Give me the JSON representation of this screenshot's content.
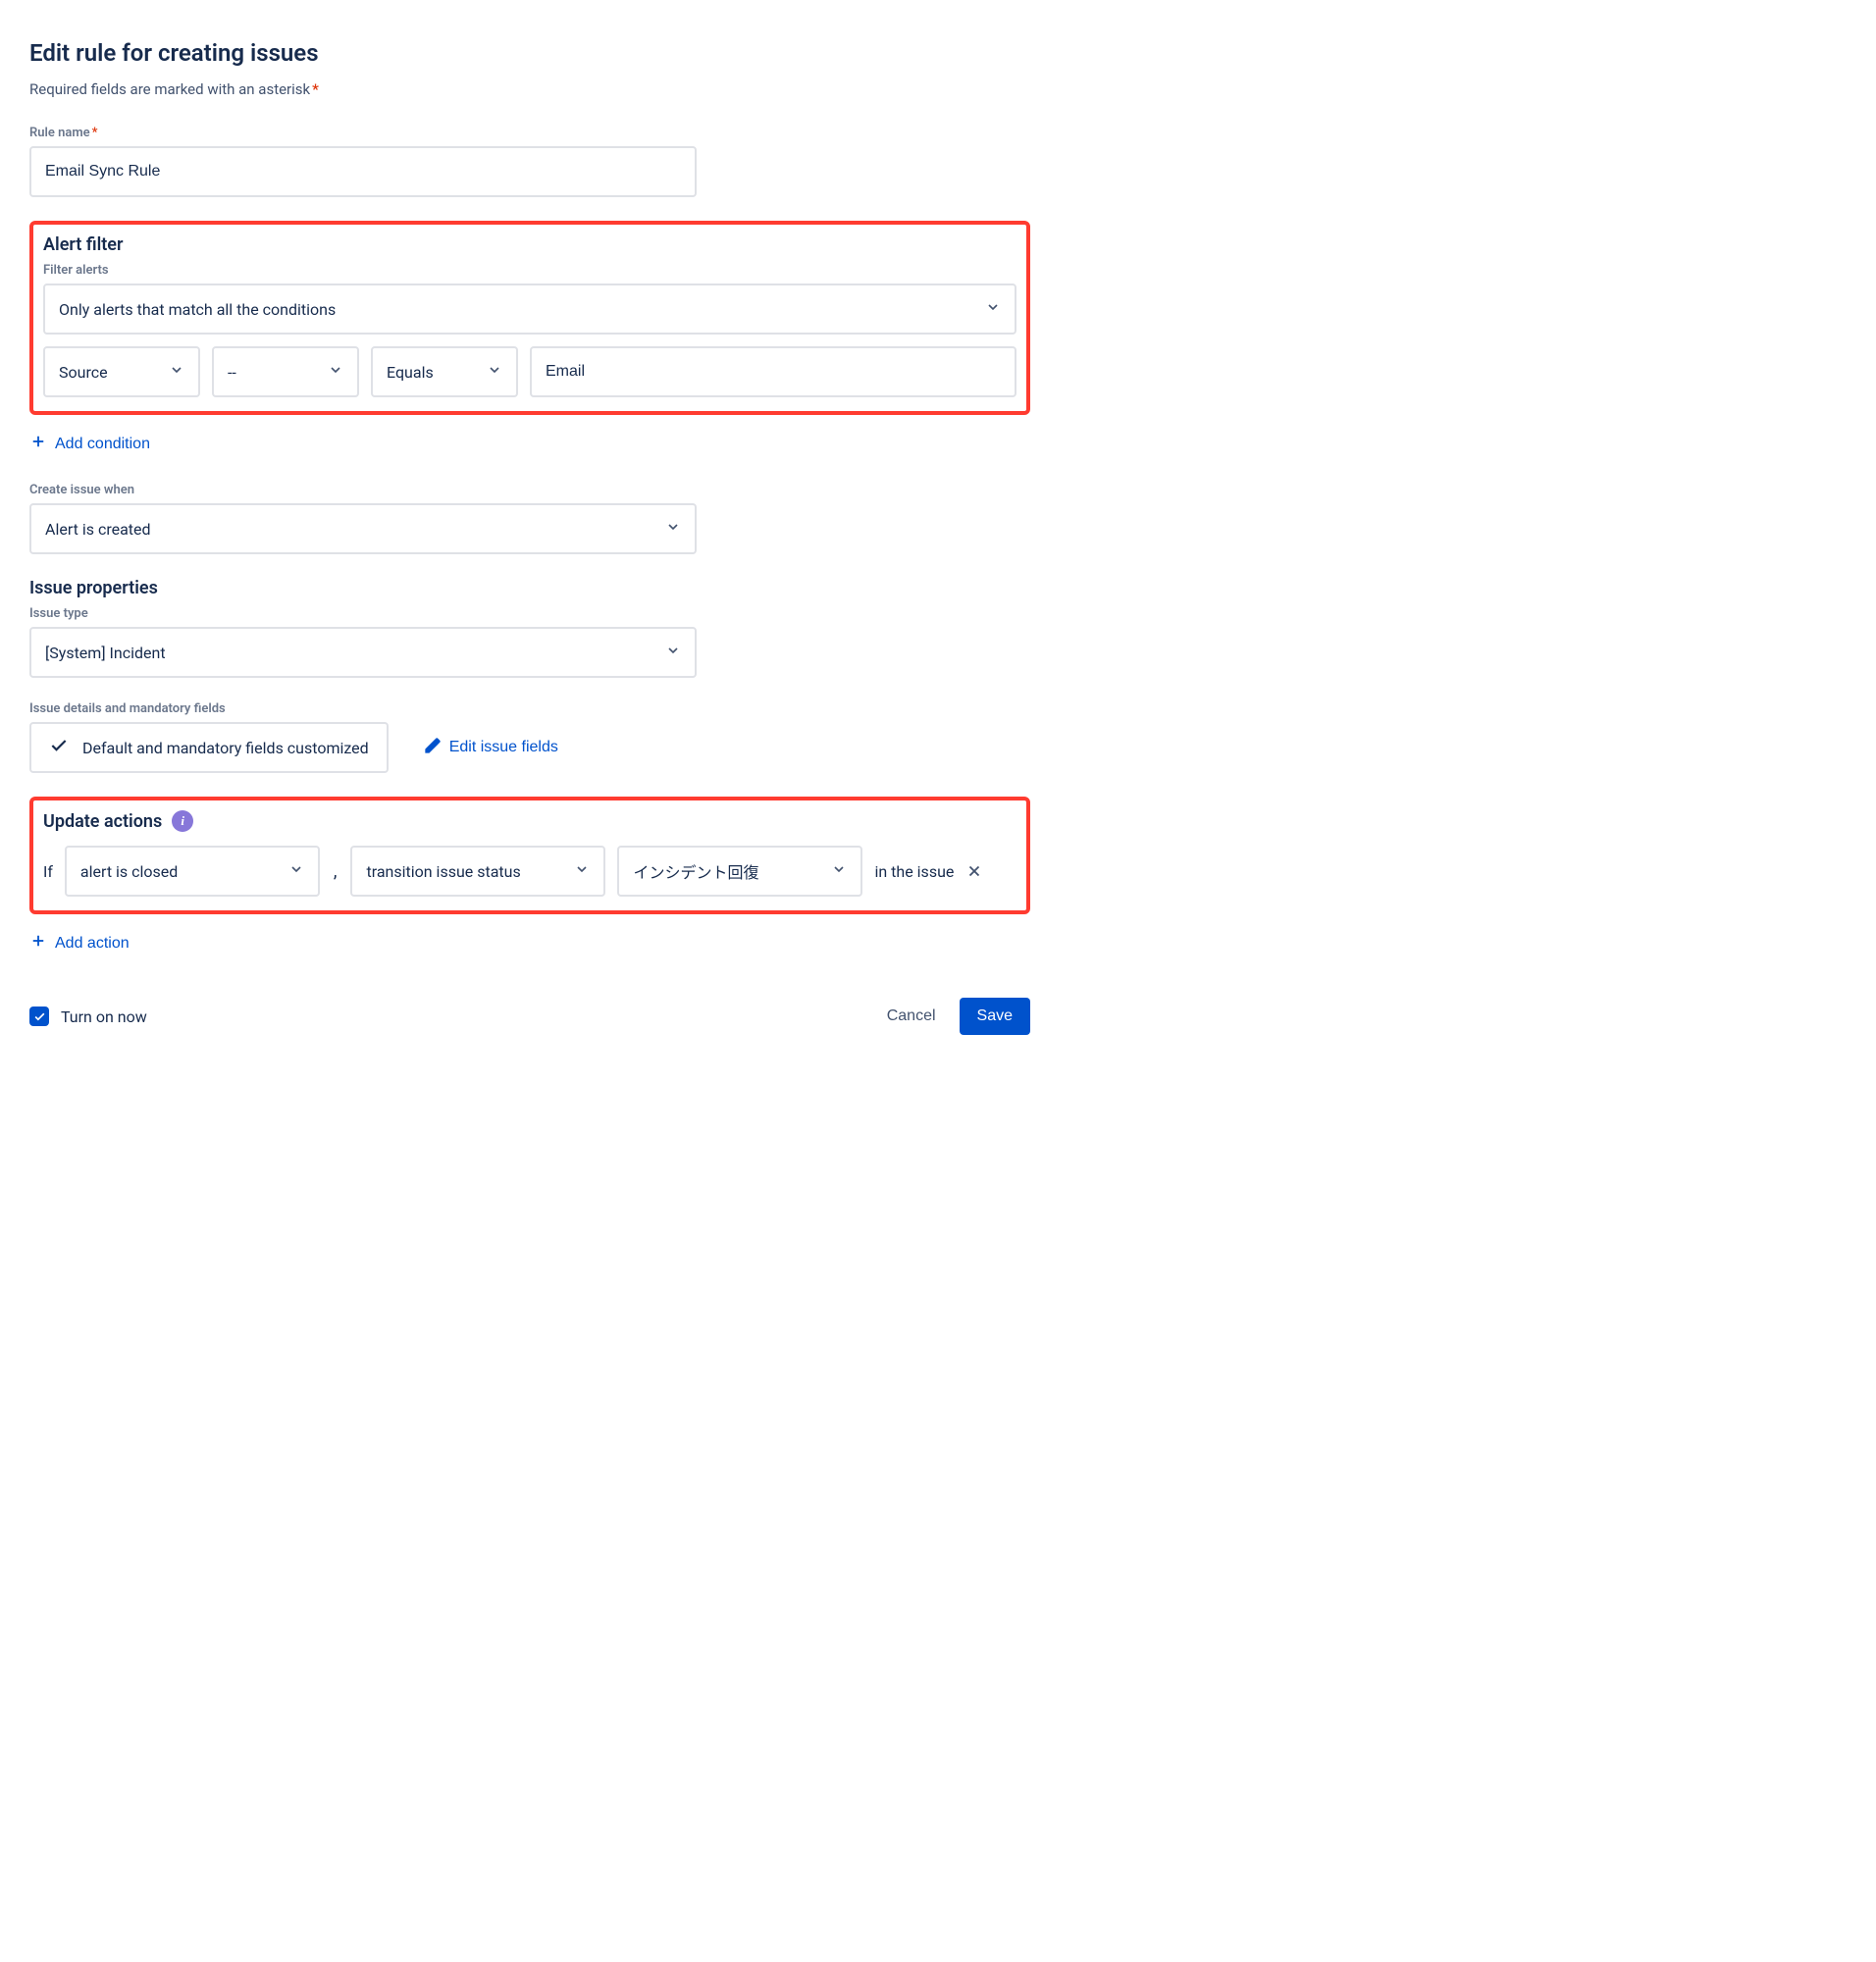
{
  "header": {
    "title": "Edit rule for creating issues",
    "subtitle": "Required fields are marked with an asterisk",
    "asterisk": "*"
  },
  "rule_name": {
    "label": "Rule name",
    "value": "Email Sync Rule"
  },
  "alert_filter": {
    "title": "Alert filter",
    "filter_alerts_label": "Filter alerts",
    "match_mode": "Only alerts that match all the conditions",
    "condition": {
      "field": "Source",
      "not": "--",
      "operator": "Equals",
      "value": "Email"
    },
    "add_condition": "Add condition"
  },
  "create_issue_when": {
    "label": "Create issue when",
    "value": "Alert is created"
  },
  "issue_properties": {
    "title": "Issue properties",
    "issue_type_label": "Issue type",
    "issue_type_value": "[System] Incident",
    "details_label": "Issue details and mandatory fields",
    "details_status": "Default and mandatory fields customized",
    "edit_fields": "Edit issue fields"
  },
  "update_actions": {
    "title": "Update actions",
    "if_text": "If",
    "trigger": "alert is closed",
    "comma": ",",
    "action": "transition issue status",
    "value": "インシデント回復",
    "suffix": "in the issue",
    "add_action": "Add action"
  },
  "footer": {
    "turn_on_label": "Turn on now",
    "turn_on_checked": true,
    "cancel": "Cancel",
    "save": "Save"
  }
}
